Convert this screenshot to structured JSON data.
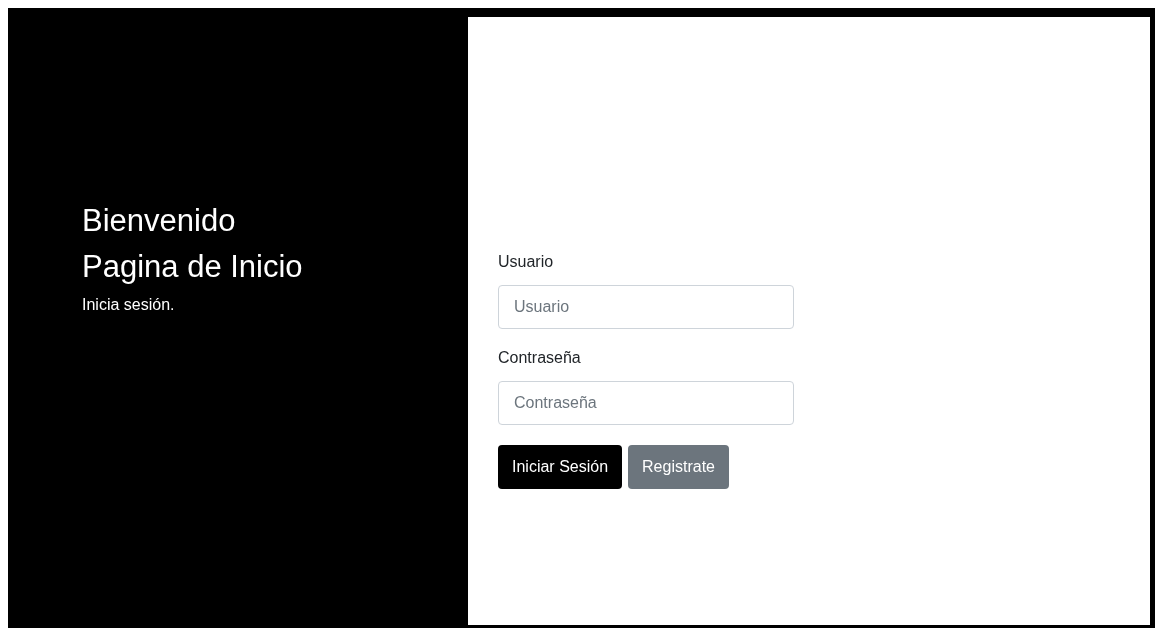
{
  "welcome": {
    "title": "Bienvenido",
    "subtitle": "Pagina de Inicio",
    "text": "Inicia sesión."
  },
  "form": {
    "fields": [
      {
        "label": "Usuario",
        "placeholder": "Usuario"
      },
      {
        "label": "Contraseña",
        "placeholder": "Contraseña"
      }
    ],
    "buttons": [
      {
        "label": "Iniciar Sesión",
        "kind": "primary"
      },
      {
        "label": "Registrate",
        "kind": "secondary"
      }
    ]
  }
}
